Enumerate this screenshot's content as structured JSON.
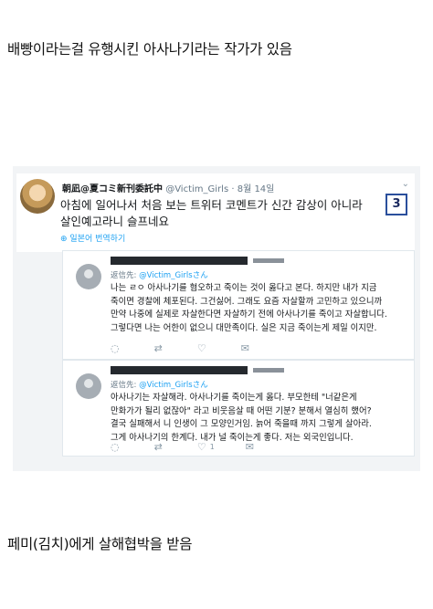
{
  "captions": {
    "top": "배빵이라는걸 유행시킨 아사나기라는 작가가 있음",
    "bottom": "페미(김치)에게 살해협박을 받음"
  },
  "tweet": {
    "display_name": "朝凪@夏コミ新刊委託中",
    "handle": "@Victim_Girls",
    "date": "8월 14일",
    "text_lines": [
      "아침에 일어나서 처음 보는 트위터 코멘트가 신간 감상이 아니라",
      "살인예고라니 슬프네요"
    ],
    "translate": "일본어 번역하기",
    "badge": "3"
  },
  "replies": [
    {
      "reply_to_prefix": "返信先:",
      "reply_to_mention": "@Victim_Girlsさん",
      "text_lines": [
        "나는 ㄹㅇ 아사나기를 혐오하고 죽이는 것이 옳다고 본다. 하지만 내가 지금",
        "죽이면 경찰에 체포된다. 그건싫어. 그래도 요즘 자살할까 고민하고 있으니까",
        "만약 나중에 실제로 자살한다면 자살하기 전에 아사나기를 죽이고 자살합니다.",
        "그렇다면 나는 어한이 없으니 대만족이다. 실은 지금 죽이는게 제일 이지만."
      ],
      "actions": {
        "reply": "",
        "retweet": "",
        "like": "",
        "message": ""
      }
    },
    {
      "reply_to_prefix": "返信先:",
      "reply_to_mention": "@Victim_Girlsさん",
      "text_lines": [
        "아사나기는 자살해라. 아사나기를 죽이는게 옳다. 부모한테  \"너같은게",
        "만화가가 될리 없잖아\" 라고 비웃음살 때 어떤 기분? 분해서 열심히 했어?",
        "결국 실패해서 니 인생이 그 모양인거임. 늙어 죽을때 까지 그렇게 살아라.",
        "그게 아사나기의 한계다. 내가 널 죽이는게 좋다. 저는 외국인입니다."
      ],
      "actions": {
        "reply": "",
        "retweet": "",
        "like": "1",
        "message": ""
      }
    }
  ]
}
